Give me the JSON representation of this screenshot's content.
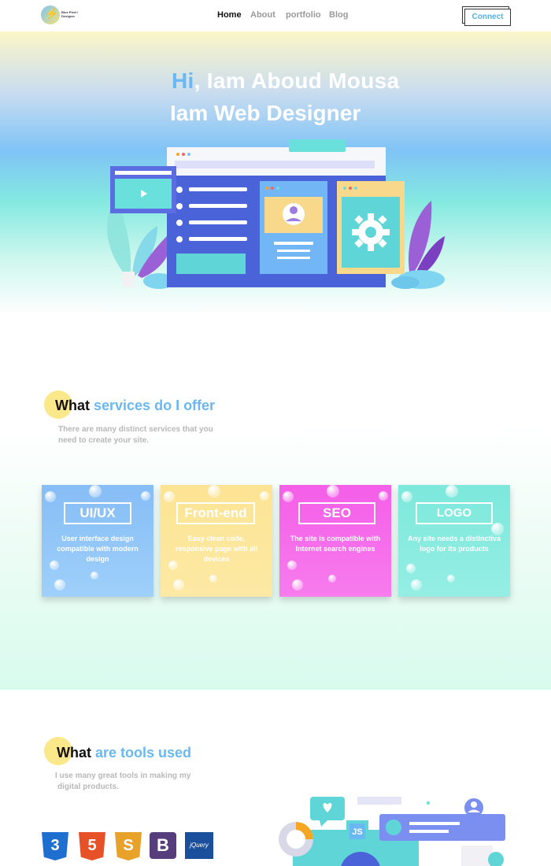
{
  "nav": {
    "logo_text": "Blue Pixel / Designer",
    "links": [
      "Home",
      "About",
      "portfolio",
      "Blog"
    ],
    "active": "Home",
    "connect_label": "Connect"
  },
  "hero": {
    "hi": "Hi",
    "line1_rest": ", Iam Aboud Mousa",
    "line2": "Iam Web Designer"
  },
  "services": {
    "title_first": "What",
    "title_rest": " services do I offer",
    "desc_line1": "There are many distinct services that you",
    "desc_line2": "need to create your site.",
    "cards": [
      {
        "label": "UI/UX",
        "text": "User interface design compatible with modern design",
        "color": "#86bdf5"
      },
      {
        "label": "Front-end",
        "text": "Easy clean code, responsive page with all devices",
        "color": "#fce493"
      },
      {
        "label": "SEO",
        "text": "The site is compatible with Internet search engines",
        "color": "#f45ee8"
      },
      {
        "label": "LOGO",
        "text": "Any site needs a distinctiva logo for its products",
        "color": "#7de8dc"
      }
    ]
  },
  "tools": {
    "title_first": "What",
    "title_rest": " are tools used",
    "desc_line1": "I use many great tools in making my",
    "desc_line2": "digital products.",
    "icons": [
      {
        "name": "css3-icon",
        "glyph": "3",
        "color": "#1f6fd1"
      },
      {
        "name": "html5-icon",
        "glyph": "5",
        "color": "#e65127"
      },
      {
        "name": "javascript-icon",
        "glyph": "S",
        "color": "#e8a22a"
      },
      {
        "name": "bootstrap-icon",
        "glyph": "B",
        "color": "#563d7c"
      },
      {
        "name": "jquery-icon",
        "glyph": "jQuery",
        "color": "#1a4f9c"
      }
    ],
    "js_badge": "JS"
  }
}
